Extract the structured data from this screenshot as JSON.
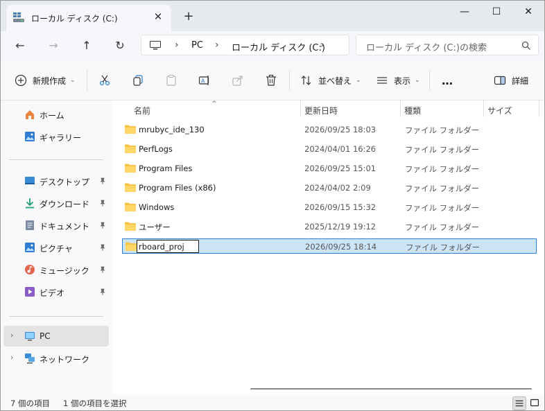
{
  "window": {
    "tab_title": "ローカル ディスク (C:)",
    "tab_close": "✕",
    "new_tab": "+",
    "minimize": "—",
    "maximize": "☐",
    "close": "✕"
  },
  "address": {
    "back": "←",
    "forward": "→",
    "up": "↑",
    "refresh": "↻",
    "crumbs": [
      "PC",
      "ローカル ディスク (C:)"
    ],
    "separator": "›",
    "search_placeholder": "ローカル ディスク (C:)の検索"
  },
  "toolbar": {
    "new_label": "新規作成",
    "sort_label": "並べ替え",
    "view_label": "表示",
    "more_label": "…",
    "details_label": "詳細"
  },
  "sidebar": {
    "quick": [
      {
        "label": "ホーム"
      },
      {
        "label": "ギャラリー"
      }
    ],
    "pinned": [
      {
        "label": "デスクトップ"
      },
      {
        "label": "ダウンロード"
      },
      {
        "label": "ドキュメント"
      },
      {
        "label": "ピクチャ"
      },
      {
        "label": "ミュージック"
      },
      {
        "label": "ビデオ"
      }
    ],
    "drives": [
      {
        "label": "PC"
      },
      {
        "label": "ネットワーク"
      }
    ],
    "expander": "›"
  },
  "list": {
    "columns": {
      "name": "名前",
      "date": "更新日時",
      "type": "種類",
      "size": "サイズ"
    },
    "sort_caret": "^",
    "rows": [
      {
        "name": "mrubyc_ide_130",
        "date": "2026/09/25 18:03",
        "type": "ファイル フォルダー"
      },
      {
        "name": "PerfLogs",
        "date": "2024/04/01 16:26",
        "type": "ファイル フォルダー"
      },
      {
        "name": "Program Files",
        "date": "2026/09/25 15:01",
        "type": "ファイル フォルダー"
      },
      {
        "name": "Program Files (x86)",
        "date": "2024/04/02 2:09",
        "type": "ファイル フォルダー"
      },
      {
        "name": "Windows",
        "date": "2026/09/15 15:32",
        "type": "ファイル フォルダー"
      },
      {
        "name": "ユーザー",
        "date": "2025/12/19 19:12",
        "type": "ファイル フォルダー"
      }
    ],
    "editing_row": {
      "name": "rboard_proj",
      "date": "2026/09/25 18:14",
      "type": "ファイル フォルダー"
    }
  },
  "status": {
    "item_count": "7 個の項目",
    "selected_count": "1 個の項目を選択"
  },
  "colors": {
    "accent": "#2d7dd2",
    "selection": "#cce4f7",
    "folder": "#f5c443"
  }
}
